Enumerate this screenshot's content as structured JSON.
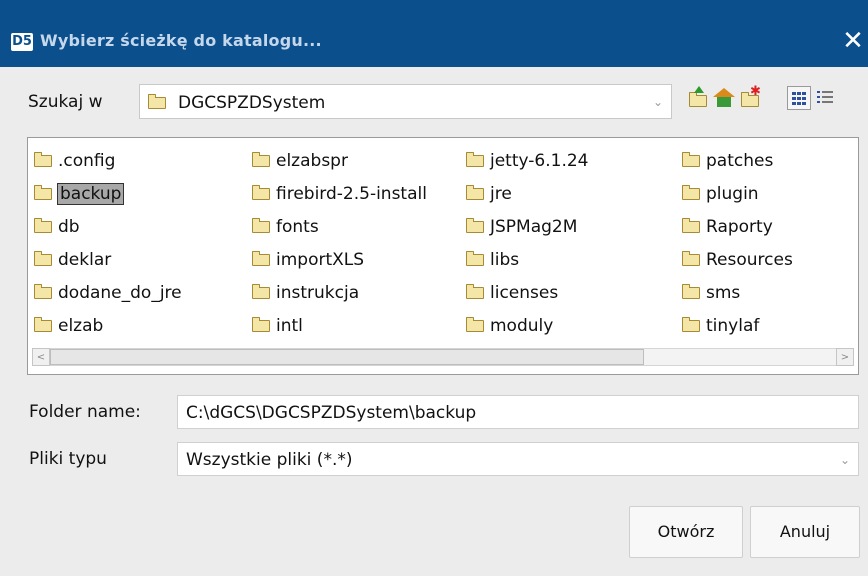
{
  "window": {
    "title": "Wybierz ścieżkę do katalogu...",
    "app_badge": "D5",
    "close_glyph": "✕"
  },
  "look_in": {
    "label": "Szukaj w",
    "value": "DGCSPZDSystem"
  },
  "toolbar": {
    "buttons": [
      {
        "icon": "up-folder-icon",
        "tooltip": "Up One Level"
      },
      {
        "icon": "home-icon",
        "tooltip": "Home"
      },
      {
        "icon": "new-folder-icon",
        "tooltip": "Create New Folder"
      },
      {
        "icon": "list-view-icon",
        "tooltip": "List",
        "selected": true
      },
      {
        "icon": "details-view-icon",
        "tooltip": "Details"
      }
    ]
  },
  "files": [
    ".config",
    "backup",
    "db",
    "deklar",
    "dodane_do_jre",
    "elzab",
    "elzabspr",
    "firebird-2.5-install",
    "fonts",
    "importXLS",
    "instrukcja",
    "intl",
    "jetty-6.1.24",
    "jre",
    "JSPMag2M",
    "libs",
    "licenses",
    "moduly",
    "patches",
    "plugin",
    "Raporty",
    "Resources",
    "sms",
    "tinylaf"
  ],
  "selected_file": "backup",
  "folder_name": {
    "label": "Folder name:",
    "value": "C:\\dGCS\\DGCSPZDSystem\\backup"
  },
  "file_type": {
    "label": "Pliki typu",
    "value": "Wszystkie pliki (*.*)"
  },
  "buttons": {
    "open": "Otwórz",
    "cancel": "Anuluj"
  },
  "colors": {
    "titlebar": "#0b4f8d",
    "selection": "#a8a8a8"
  }
}
